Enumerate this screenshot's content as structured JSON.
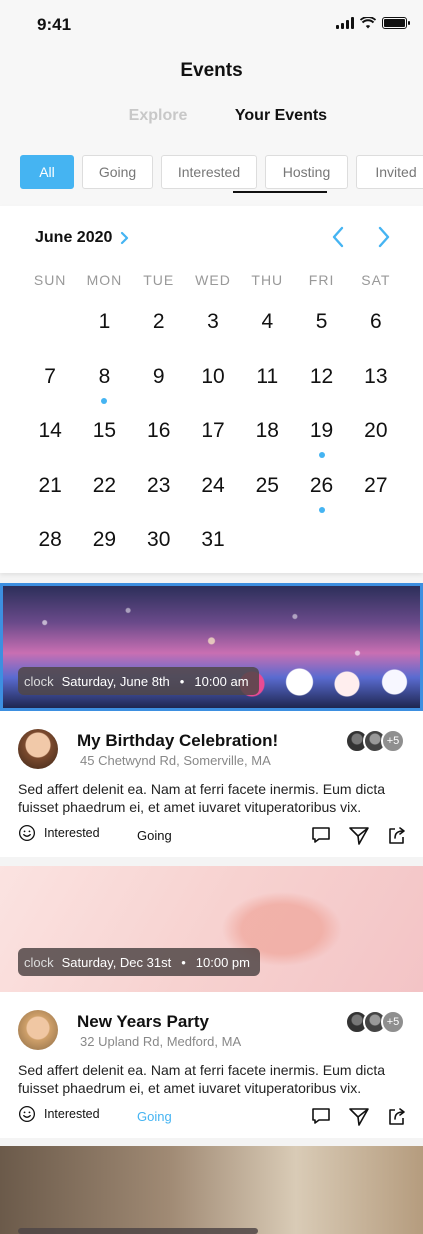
{
  "status": {
    "time": "9:41"
  },
  "header": {
    "title": "Events",
    "tabs": [
      "Explore",
      "Your Events"
    ]
  },
  "filters": [
    "All",
    "Going",
    "Interested",
    "Hosting",
    "Invited"
  ],
  "calendar": {
    "month": "June 2020",
    "weekdays": [
      "SUN",
      "MON",
      "TUE",
      "WED",
      "THU",
      "FRI",
      "SAT"
    ],
    "days": [
      "",
      "1",
      "2",
      "3",
      "4",
      "5",
      "6",
      "7",
      "8",
      "9",
      "10",
      "11",
      "12",
      "13",
      "14",
      "15",
      "16",
      "17",
      "18",
      "19",
      "20",
      "21",
      "22",
      "23",
      "24",
      "25",
      "26",
      "27",
      "28",
      "29",
      "30",
      "31",
      "",
      "",
      ""
    ],
    "event_days": [
      "8",
      "19",
      "26"
    ]
  },
  "events": [
    {
      "clock": "clock",
      "date": "Saturday, June 8th",
      "time": "10:00 am",
      "name": "My Birthday Celebration!",
      "address": "45 Chetwynd Rd, Somerville, MA",
      "more_attendees": "+5",
      "description": "Sed affert delenit ea. Nam at ferri facete inermis. Eum dicta fuisset phaedrum ei, et amet iuvaret vituperatoribus vix.",
      "interested_label": "Interested",
      "going_label": "Going"
    },
    {
      "clock": "clock",
      "date": "Saturday, Dec 31st",
      "time": "10:00 pm",
      "name": "New Years Party",
      "address": "32 Upland Rd, Medford, MA",
      "more_attendees": "+5",
      "description": "Sed affert delenit ea. Nam at ferri facete inermis. Eum dicta fuisset phaedrum ei, et amet iuvaret vituperatoribus vix.",
      "interested_label": "Interested",
      "going_label": "Going"
    }
  ],
  "colors": {
    "accent": "#45b4f2",
    "selected_border": "#3d8fe0"
  }
}
